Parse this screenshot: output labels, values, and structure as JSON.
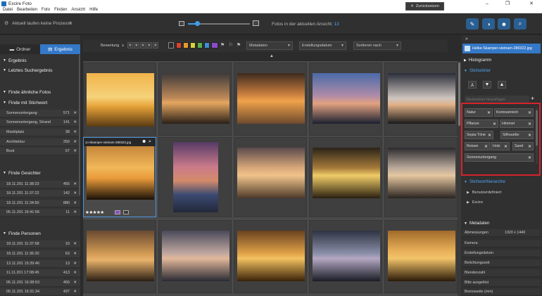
{
  "window": {
    "title": "Excire Foto",
    "min": "–",
    "max": "❐",
    "close": "✕"
  },
  "menu": [
    "Datei",
    "Bearbeiten",
    "Foto",
    "Finden",
    "Ansicht",
    "Hilfe"
  ],
  "toolbar": {
    "status_text": "Aktuell laufen keine Prozesse",
    "photo_count_label": "Fotos in der aktuellen Ansicht:",
    "photo_count": "13",
    "zoom_level": 0.15
  },
  "left_panel": {
    "tabs": [
      "Ordner",
      "Ergebnis"
    ],
    "active_tab": "Ergebnis",
    "sections": {
      "ergebnis": "Ergebnis",
      "letztes": "Letztes Suchergebnis",
      "aehnliche": "Finde ähnliche Fotos",
      "stichwort": "Finde mit Stichwort",
      "gesichter": "Finde Gesichter",
      "personen": "Finde Personen"
    },
    "keyword_rows": [
      {
        "name": "Sonnenuntergang",
        "count": "571"
      },
      {
        "name": "Sonnenuntergang, Strand",
        "count": "141"
      },
      {
        "name": "Marktplatz",
        "count": "38"
      },
      {
        "name": "Architektur",
        "count": "250"
      },
      {
        "name": "Boot",
        "count": "67"
      }
    ],
    "face_rows": [
      {
        "name": "18.11.201 11:38:23",
        "count": "455"
      },
      {
        "name": "18.11.201 11:37:22",
        "count": "142"
      },
      {
        "name": "18.11.201 11:34:50",
        "count": "880"
      },
      {
        "name": "05.11.201 16:41:56",
        "count": "11"
      }
    ],
    "person_rows": [
      {
        "name": "18.11.201 11:37:58",
        "count": "10"
      },
      {
        "name": "18.11.201 11:36:20",
        "count": "63"
      },
      {
        "name": "13.11.201 15:39:46",
        "count": "13"
      },
      {
        "name": "11.11.201 17:08:45",
        "count": "413"
      },
      {
        "name": "05.11.201 16:38:53",
        "count": "450"
      },
      {
        "name": "05.11.201 16:31:34",
        "count": "437"
      }
    ]
  },
  "filter": {
    "rating_label": "Bewertung",
    "rating_op": "≥",
    "dropdowns": [
      "Metadaten",
      "Erstellungsdatum",
      "Sortieren nach"
    ],
    "reset_label": "Zurücksetzen",
    "colors": [
      "#d8432f",
      "#e39a2e",
      "#d8d23a",
      "#5bb04a",
      "#3b8fd6",
      "#8a4cc9"
    ]
  },
  "grid": {
    "selected_filename": "Jo-Skamper-vietnam-280322.jpg",
    "selected_rating": "★★★★★",
    "thumbs": [
      {
        "sky": "linear-gradient(#f0b34a 0%, #f6d27a 45%, #e7a33a 62%, #5a3a12 100%)"
      },
      {
        "sky": "linear-gradient(#3e3a3a 0%, #c08a58 50%, #e6a860 58%, #2a2018 100%)"
      },
      {
        "sky": "linear-gradient(#3d2a1e 0%, #c27a3d 40%, #f0a24a 55%, #6d4a2d 100%)"
      },
      {
        "sky": "linear-gradient(#4a6aa8 0%, #b08ca8 45%, #e2a280 60%, #1b2030 100%)"
      },
      {
        "sky": "linear-gradient(#2a2e3a 0%, #cfc5c0 50%, #e2b288 62%, #1a1a1a 100%)"
      },
      {
        "sky": "linear-gradient(#c5873a 0%, #f1b759 40%, #e89a3a 60%, #1a1208 100%)"
      },
      {
        "sky": "linear-gradient(#553a66 0%, #c97a8a 35%, #d48b6a 55%, #3b4a72 75%, #23283a 100%)"
      },
      {
        "sky": "linear-gradient(#5a4a4a 0%, #d8a87a 40%, #f1c38a 55%, #4d3a2a 100%)"
      },
      {
        "sky": "linear-gradient(#2a2418 0%, #a57a3a 40%, #f0cc68 55%, #2a2010 100%)"
      },
      {
        "sky": "linear-gradient(#2b2a2e 0%, #b8a89a 40%, #e5c7a0 55%, #2a2420 100%)"
      },
      {
        "sky": "linear-gradient(#6a4a30 0%, #d09a54 45%, #e8b26a 58%, #2a1e14 100%)"
      },
      {
        "sky": "linear-gradient(#4a4a5a 0%, #c0a8a0 45%, #e2b89a 55%, #2a2a34 100%)"
      },
      {
        "sky": "linear-gradient(#6a4220 0%, #e0a248 45%, #f3c160 55%, #3a2208 100%)"
      },
      {
        "sky": "linear-gradient(#2e3442 0%, #8a8ea8 45%, #b4a8c2 55%, #1a1c26 100%)"
      },
      {
        "sky": "linear-gradient(#a06a2a 0%, #e8b058 40%, #f2c46a 55%, #2a1a08 100%)"
      }
    ]
  },
  "right_panel": {
    "filename": "Helke-Skamper-vietnam-280322.jpg",
    "histogramm": "Histogramm",
    "stichwoerter": "Stichwörter",
    "add_placeholder": "Stichwörter hinzufügen",
    "tags": [
      "Natur",
      "Kontrastreich",
      "Pflanze",
      "Himmel",
      "Sepia Töne",
      "Silhouette",
      "Reisen",
      "Holz",
      "Sand",
      "Sonnenuntergang"
    ],
    "hierarchy": "Stichworthierarchie",
    "tree": [
      "Benutzerdefiniert",
      "Excire"
    ],
    "metadata_title": "Metadaten",
    "metadata": [
      {
        "k": "Abmessungen",
        "v": "1920 x 1440"
      },
      {
        "k": "Kamera",
        "v": ""
      },
      {
        "k": "Erstellungsdatum",
        "v": ""
      },
      {
        "k": "Belichtungszeit",
        "v": ""
      },
      {
        "k": "Blendenzahl",
        "v": ""
      },
      {
        "k": "Blitz ausgelöst",
        "v": ""
      },
      {
        "k": "Brennweite (mm)",
        "v": ""
      }
    ]
  }
}
